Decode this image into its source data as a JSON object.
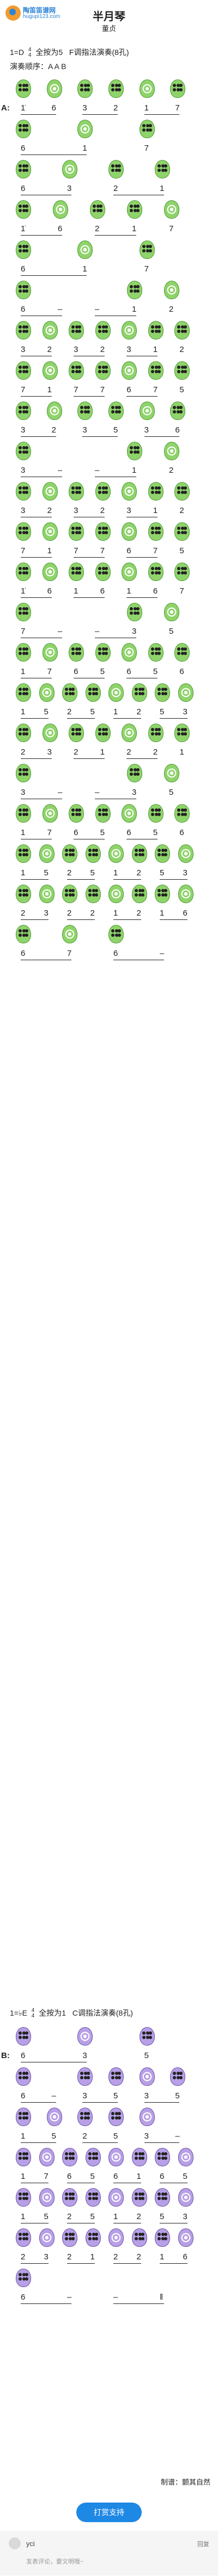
{
  "header": {
    "logo_name": "陶笛笛谱网",
    "logo_url": "hugupi123.com",
    "title": "半月琴",
    "composer": "董贞"
  },
  "key_info": {
    "key": "1=D",
    "time_top": "4",
    "time_bottom": "4",
    "fingering": "全按为5",
    "tone": "F调指法演奏(8孔)",
    "order_label": "演奏顺序：A A B"
  },
  "section_a_label": "A:",
  "section_b_header": {
    "key": "1=♭E",
    "time_top": "4",
    "time_bottom": "4",
    "fingering": "全按为1",
    "tone": "C调指法演奏(8孔)"
  },
  "section_b_label": "B:",
  "small_tag": "颤音",
  "rows": [
    [
      "1̇",
      "6",
      "3",
      "2",
      "1",
      "7"
    ],
    [
      "6",
      "1",
      "7"
    ],
    [
      "6",
      "3",
      "2",
      "1"
    ],
    [
      "1̇",
      "6",
      "2",
      "1",
      "7"
    ],
    [
      "6",
      "1",
      "7"
    ],
    [
      "6",
      "–",
      "–",
      "1",
      "2"
    ],
    [
      "3",
      "2",
      "3",
      "2",
      "3",
      "1",
      "2"
    ],
    [
      "7",
      "1",
      "7",
      "7",
      "6",
      "7",
      "5"
    ],
    [
      "3",
      "2",
      "3",
      "5",
      "3",
      "6"
    ],
    [
      "3",
      "–",
      "–",
      "1",
      "2"
    ],
    [
      "3",
      "2",
      "3",
      "2",
      "3",
      "1",
      "2"
    ],
    [
      "7",
      "1",
      "7",
      "7",
      "6",
      "7",
      "5"
    ],
    [
      "1̇",
      "6",
      "1",
      "6",
      "1",
      "6",
      "7"
    ],
    [
      "7",
      "–",
      "–",
      "3",
      "5"
    ],
    [
      "1",
      "7",
      "6",
      "5",
      "6",
      "5",
      "6"
    ],
    [
      "1",
      "5",
      "2",
      "5",
      "1",
      "2",
      "5",
      "3"
    ],
    [
      "2",
      "3",
      "2",
      "1",
      "2",
      "2",
      "1"
    ],
    [
      "3",
      "–",
      "–",
      "3",
      "5"
    ],
    [
      "1",
      "7",
      "6",
      "5",
      "6",
      "5",
      "6"
    ],
    [
      "1",
      "5",
      "2",
      "5",
      "1",
      "2",
      "5",
      "3"
    ],
    [
      "2",
      "3",
      "2",
      "2",
      "1",
      "2",
      "1",
      "6"
    ],
    [
      "6",
      "7",
      "6",
      "–"
    ],
    [
      "6",
      "3",
      "5"
    ],
    [
      "6",
      "–",
      "3",
      "5",
      "3",
      "5"
    ],
    [
      "1",
      "5",
      "2",
      "5",
      "3",
      "–"
    ],
    [
      "1",
      "7",
      "6",
      "5",
      "6",
      "1",
      "6",
      "5"
    ],
    [
      "1",
      "5",
      "2",
      "5",
      "1",
      "2",
      "5",
      "3"
    ],
    [
      "2",
      "3",
      "2",
      "1",
      "2",
      "2",
      "1",
      "6"
    ],
    [
      "6",
      "–",
      "–",
      "‖"
    ]
  ],
  "footer": {
    "maker": "制谱：颤其自然",
    "reward": "打赏支持",
    "comment_user": "yci",
    "comment_reply": "回复",
    "comment_placeholder": "发表评论，要文明哦~"
  },
  "colors": {
    "green": "#8fd36b",
    "purple": "#b7a0e6",
    "link": "#2d84d6",
    "button": "#1e88e5"
  }
}
